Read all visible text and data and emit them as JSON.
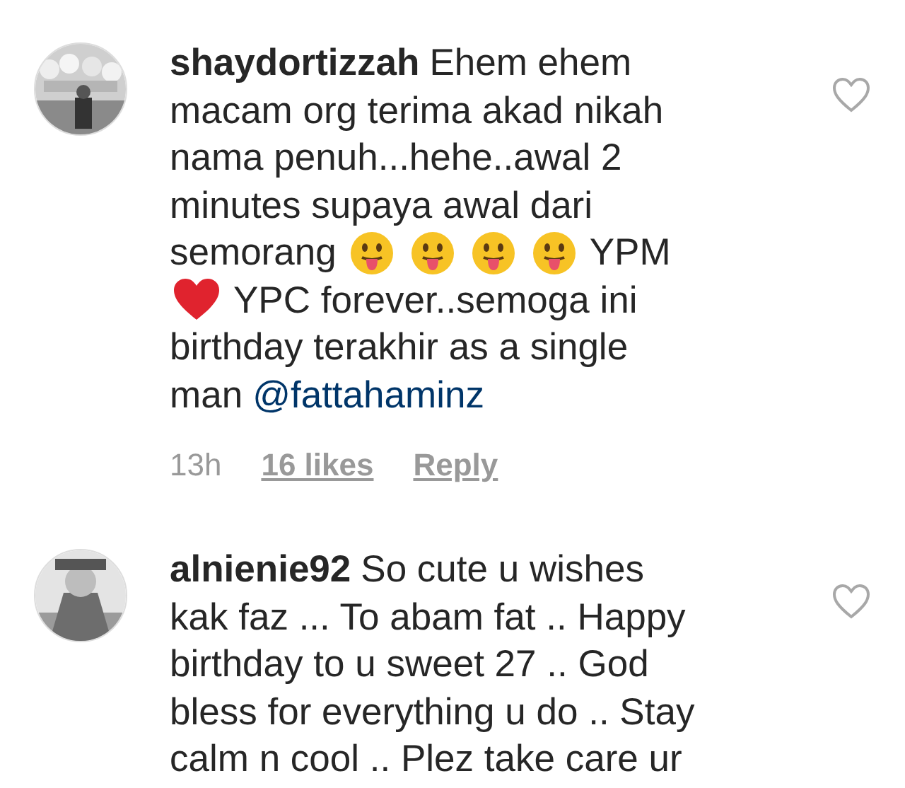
{
  "comments": [
    {
      "lines": [
        [
          {
            "kind": "username",
            "text": "shaydortizzah"
          },
          {
            "kind": "text",
            "text": "Ehem ehem"
          }
        ],
        [
          {
            "kind": "text",
            "text": "macam org terima akad nikah"
          }
        ],
        [
          {
            "kind": "text",
            "text": "nama penuh...hehe..awal 2"
          }
        ],
        [
          {
            "kind": "text",
            "text": "minutes supaya awal dari"
          }
        ],
        [
          {
            "kind": "text",
            "text": "semorang"
          },
          {
            "kind": "tongue-emoji"
          },
          {
            "kind": "tongue-emoji"
          },
          {
            "kind": "tongue-emoji"
          },
          {
            "kind": "tongue-emoji"
          },
          {
            "kind": "text",
            "text": "YPM"
          }
        ],
        [
          {
            "kind": "heart-emoji"
          },
          {
            "kind": "text",
            "text": "YPC forever..semoga ini"
          }
        ],
        [
          {
            "kind": "text",
            "text": "birthday terakhir as a single"
          }
        ],
        [
          {
            "kind": "text",
            "text": "man"
          },
          {
            "kind": "mention",
            "text": "@fattahaminz"
          }
        ]
      ],
      "time": "13h",
      "likes": "16 likes",
      "reply": "Reply",
      "liked": false
    },
    {
      "lines": [
        [
          {
            "kind": "username",
            "text": "alnienie92"
          },
          {
            "kind": "text",
            "text": "So cute u wishes"
          }
        ],
        [
          {
            "kind": "text",
            "text": "kak faz ... To abam fat .. Happy"
          }
        ],
        [
          {
            "kind": "text",
            "text": "birthday to u sweet 27 .. God"
          }
        ],
        [
          {
            "kind": "text",
            "text": "bless for everything u do .. Stay"
          }
        ],
        [
          {
            "kind": "text",
            "text": "calm n cool .. Plez take care ur"
          }
        ]
      ],
      "liked": false
    }
  ]
}
